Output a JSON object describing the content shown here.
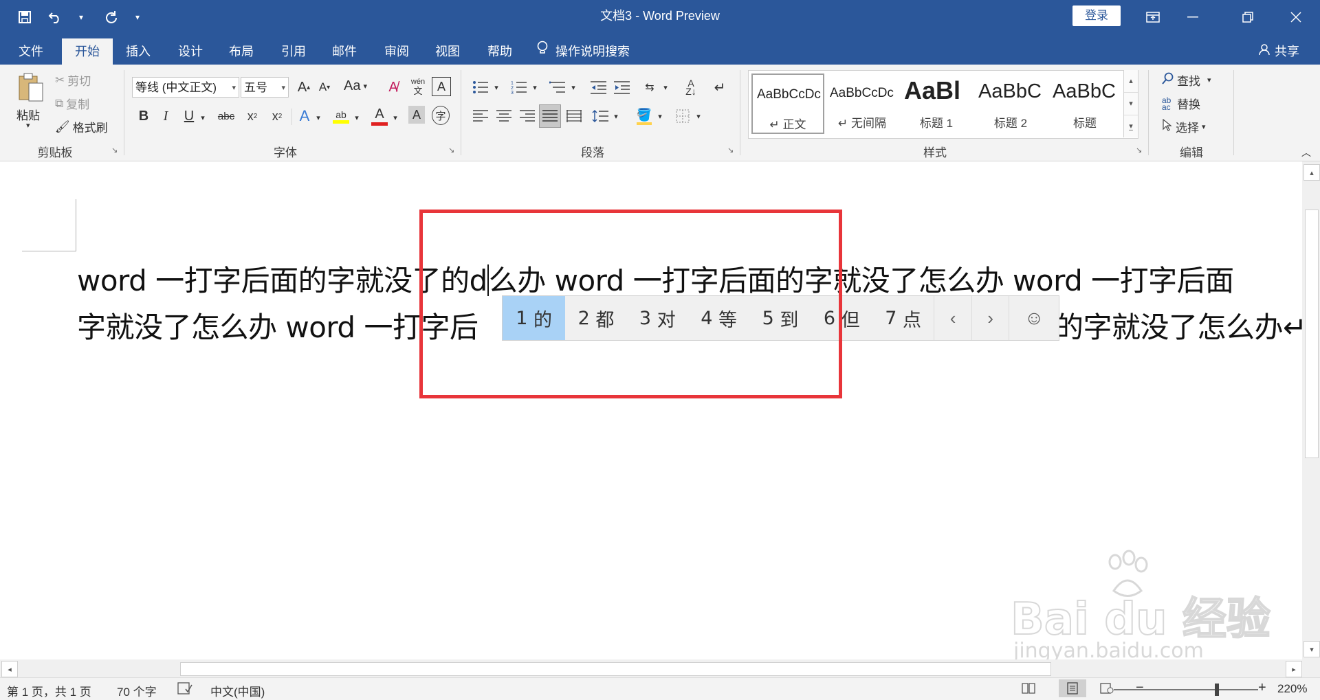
{
  "window": {
    "title": "文档3  -  Word Preview",
    "login_label": "登录"
  },
  "quick_access": {
    "save": "save-icon",
    "undo": "undo-icon",
    "redo": "redo-icon",
    "customize": "▾"
  },
  "tabs": [
    {
      "label": "文件"
    },
    {
      "label": "开始"
    },
    {
      "label": "插入"
    },
    {
      "label": "设计"
    },
    {
      "label": "布局"
    },
    {
      "label": "引用"
    },
    {
      "label": "邮件"
    },
    {
      "label": "审阅"
    },
    {
      "label": "视图"
    },
    {
      "label": "帮助"
    },
    {
      "label": "操作说明搜索"
    }
  ],
  "share_label": "共享",
  "ribbon": {
    "clipboard": {
      "paste": "粘贴",
      "cut": "剪切",
      "copy": "复制",
      "format_painter": "格式刷",
      "label": "剪贴板"
    },
    "font": {
      "font_name": "等线 (中文正文)",
      "font_size": "五号",
      "change_case": "Aa",
      "label": "字体",
      "phonetic": "wén"
    },
    "paragraph": {
      "label": "段落"
    },
    "styles": {
      "label": "样式",
      "items": [
        {
          "sample": "AaBbCcDc",
          "name": "↵ 正文"
        },
        {
          "sample": "AaBbCcDc",
          "name": "↵ 无间隔"
        },
        {
          "sample": "AaBl",
          "name": "标题 1"
        },
        {
          "sample": "AaBbC",
          "name": "标题 2"
        },
        {
          "sample": "AaBbC",
          "name": "标题"
        }
      ]
    },
    "editing": {
      "find": "查找",
      "replace": "替换",
      "select": "选择",
      "label": "编辑"
    }
  },
  "document": {
    "line1_before": "word 一打字后面的字就没了的d",
    "line1_after": "么办 word 一打字后面的字就没了怎么办 word 一打字后面",
    "line2_before": "字就没了怎么办 word 一打字后",
    "line2_after": "的字就没了怎么办↵"
  },
  "ime": {
    "candidates": [
      {
        "num": "1",
        "char": "的"
      },
      {
        "num": "2",
        "char": "都"
      },
      {
        "num": "3",
        "char": "对"
      },
      {
        "num": "4",
        "char": "等"
      },
      {
        "num": "5",
        "char": "到"
      },
      {
        "num": "6",
        "char": "但"
      },
      {
        "num": "7",
        "char": "点"
      }
    ],
    "prev": "‹",
    "next": "›",
    "emoji": "☺"
  },
  "status": {
    "page": "第 1 页，共 1 页",
    "words": "70 个字",
    "language": "中文(中国)",
    "zoom": "220%",
    "zoom_minus": "−",
    "zoom_plus": "+"
  },
  "watermark": {
    "brand": "Bai du 经验",
    "url": "jingyan.baidu.com"
  },
  "colors": {
    "title_bar": "#2b579a",
    "ime_selected": "#a9d2f6",
    "annotation_box": "#e8353a"
  }
}
